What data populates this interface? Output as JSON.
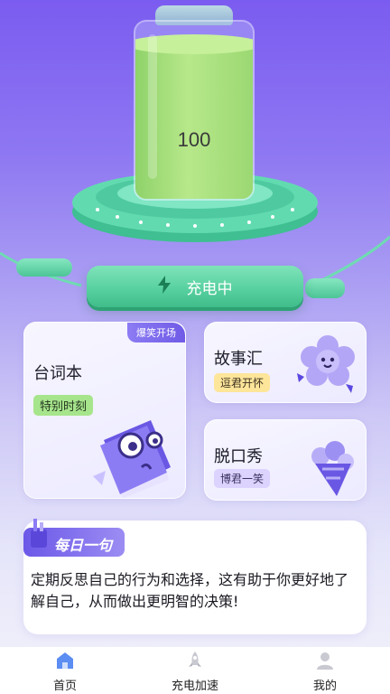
{
  "battery": {
    "level_text": "100",
    "fill_fraction": 0.88
  },
  "charge_button": {
    "label": "充电中",
    "icon": "lightning-bolt-icon"
  },
  "cards": {
    "script": {
      "title": "台词本",
      "tag": "特别时刻",
      "ribbon": "爆笑开场"
    },
    "story": {
      "title": "故事汇",
      "tag": "逗君开怀"
    },
    "standup": {
      "title": "脱口秀",
      "tag": "博君一笑"
    }
  },
  "quote": {
    "badge": "每日一句",
    "text": "定期反思自己的行为和选择，这有助于你更好地了解自己，从而做出更明智的决策!"
  },
  "tabbar": {
    "items": [
      {
        "label": "首页",
        "icon": "home-icon",
        "active": true
      },
      {
        "label": "充电加速",
        "icon": "rocket-icon",
        "active": false
      },
      {
        "label": "我的",
        "icon": "user-icon",
        "active": false
      }
    ]
  },
  "colors": {
    "accent_green": "#55cf9e",
    "accent_purple": "#6c58e8",
    "battery_green": "#9bd872"
  }
}
